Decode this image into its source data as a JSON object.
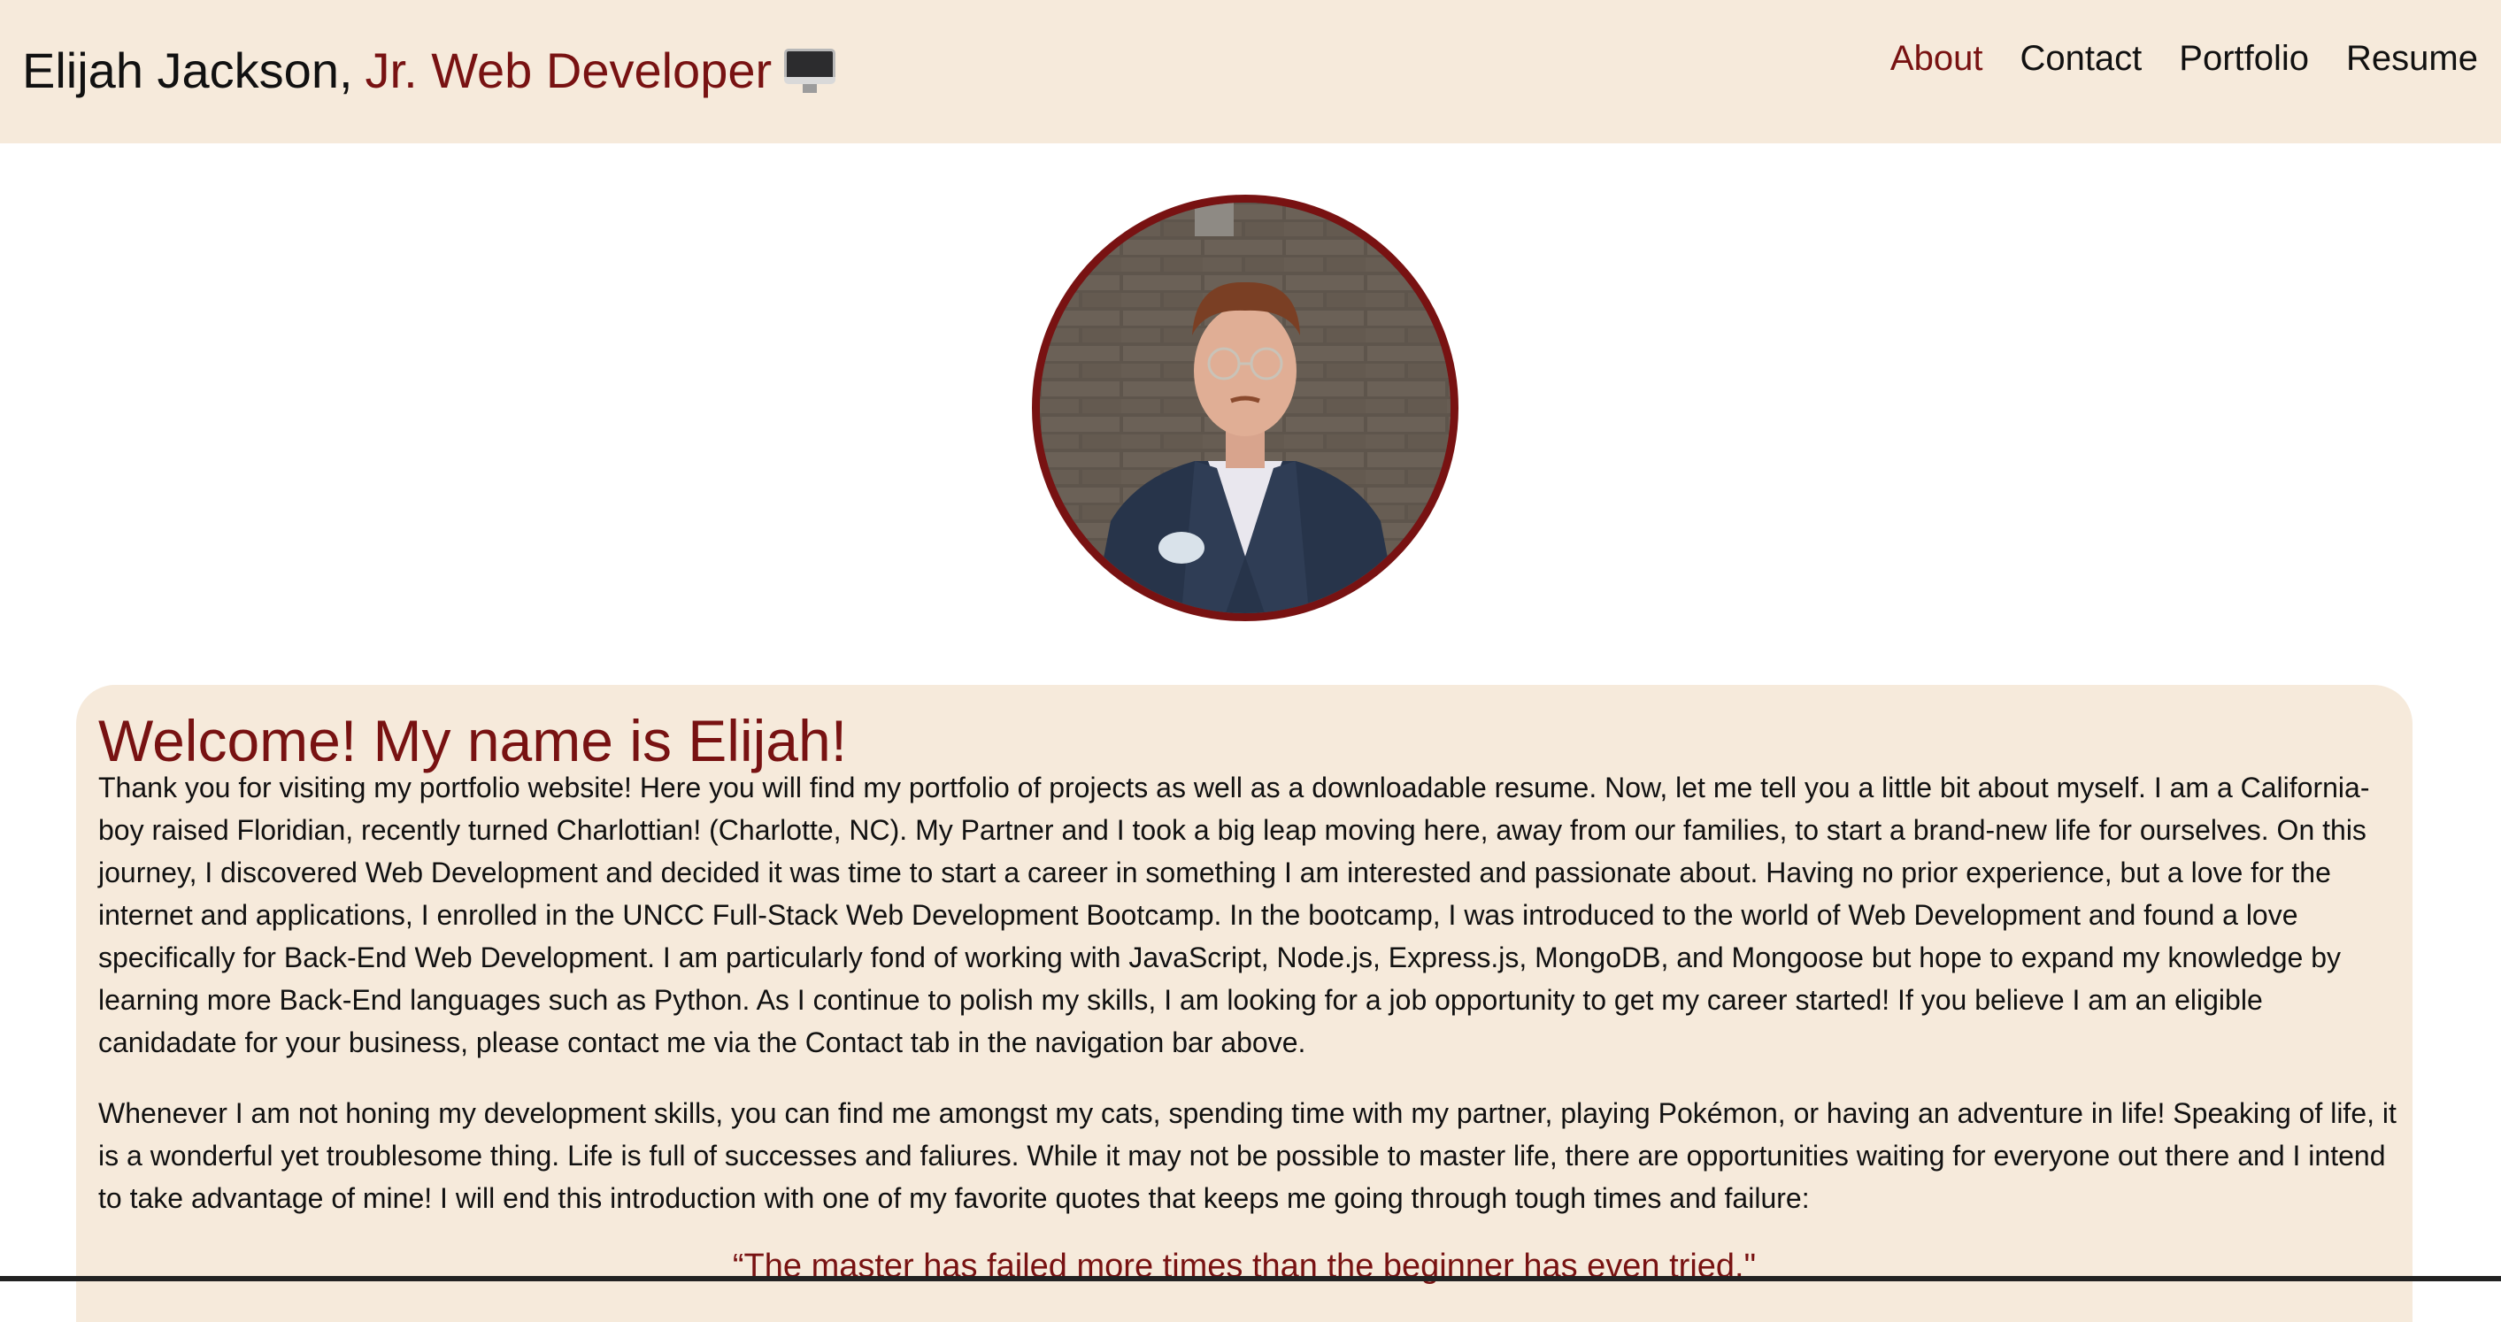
{
  "header": {
    "name": "Elijah Jackson,",
    "role": "Jr. Web Developer",
    "role_icon": "desktop-computer-icon"
  },
  "nav": {
    "items": [
      {
        "label": "About",
        "active": true
      },
      {
        "label": "Contact",
        "active": false
      },
      {
        "label": "Portfolio",
        "active": false
      },
      {
        "label": "Resume",
        "active": false
      }
    ]
  },
  "about": {
    "heading": "Welcome! My name is Elijah!",
    "paragraph1": "Thank you for visiting my portfolio website! Here you will find my portfolio of projects as well as a downloadable resume. Now, let me tell you a little bit about myself. I am a California-boy raised Floridian, recently turned Charlottian! (Charlotte, NC). My Partner and I took a big leap moving here, away from our families, to start a brand-new life for ourselves. On this journey, I discovered Web Development and decided it was time to start a career in something I am interested and passionate about. Having no prior experience, but a love for the internet and applications, I enrolled in the UNCC Full-Stack Web Development Bootcamp. In the bootcamp, I was introduced to the world of Web Development and found a love specifically for Back-End Web Development. I am particularly fond of working with JavaScript, Node.js, Express.js, MongoDB, and Mongoose but hope to expand my knowledge by learning more Back-End languages such as Python. As I continue to polish my skills, I am looking for a job opportunity to get my career started! If you believe I am an eligible canidadate for your business, please contact me via the Contact tab in the navigation bar above.",
    "paragraph2": "Whenever I am not honing my development skills, you can find me amongst my cats, spending time with my partner, playing Pokémon, or having an adventure in life! Speaking of life, it is a wonderful yet troublesome thing. Life is full of successes and faliures. While it may not be possible to master life, there are opportunities waiting for everyone out there and I intend to take advantage of mine! I will end this introduction with one of my favorite quotes that keeps me going through tough times and failure:",
    "quote": "“The master has failed more times than the beginner has even tried.\""
  },
  "colors": {
    "accent": "#781212",
    "header_bg": "#f6eadb",
    "card_bg": "#f6eadb",
    "text": "#111111"
  }
}
